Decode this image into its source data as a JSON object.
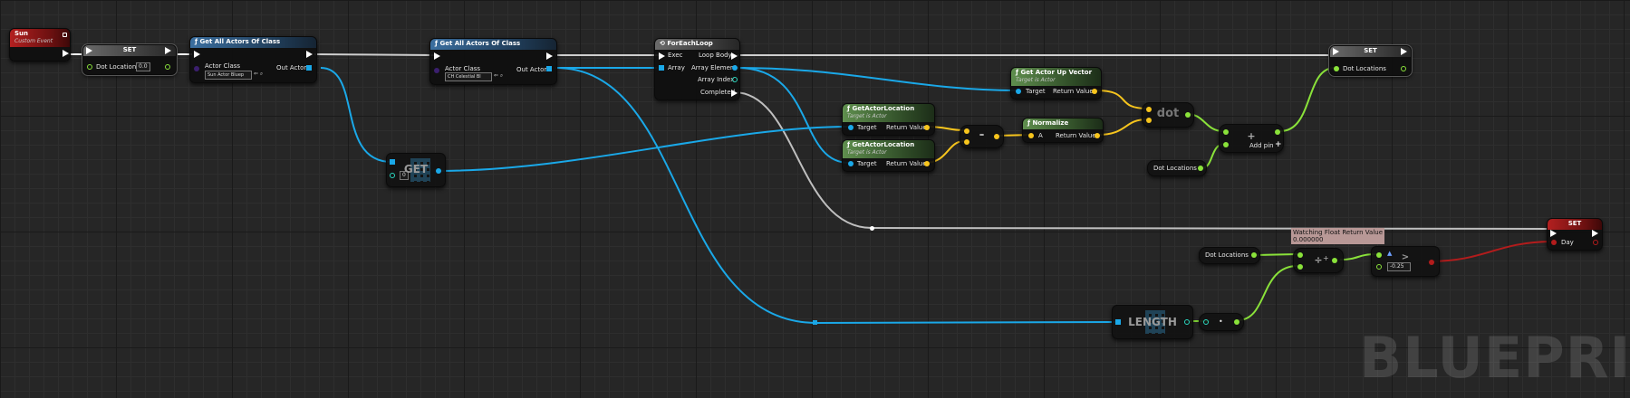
{
  "watermark": "BLUEPRINT",
  "colors": {
    "exec": "#ffffff",
    "object": "#1aa8e8",
    "vector": "#f7c51d",
    "float": "#8ae23a",
    "bool": "#b31c1c",
    "integer": "#2ad8c0"
  },
  "nodes": {
    "sun_event": {
      "title": "Sun",
      "subtitle": "Custom Event"
    },
    "set_dot_1": {
      "title": "SET",
      "pin": "Dot Locations",
      "value": "0.0"
    },
    "get_all_1": {
      "title": "Get All Actors Of Class",
      "in": "Actor Class",
      "out": "Out Actors",
      "class_value": "Sun Actor Bluep"
    },
    "get_all_2": {
      "title": "Get All Actors Of Class",
      "in": "Actor Class",
      "out": "Out Actors",
      "class_value": "CH Celestial Bl"
    },
    "foreach": {
      "title": "ForEachLoop",
      "exec": "Exec",
      "array": "Array",
      "loop_body": "Loop Body",
      "array_element": "Array Element",
      "array_index": "Array Index",
      "completed": "Completed"
    },
    "up_vector": {
      "title": "Get Actor Up Vector",
      "subtitle": "Target is Actor",
      "target": "Target",
      "ret": "Return Value"
    },
    "loc1": {
      "title": "GetActorLocation",
      "subtitle": "Target is Actor",
      "target": "Target",
      "ret": "Return Value"
    },
    "loc2": {
      "title": "GetActorLocation",
      "subtitle": "Target is Actor",
      "target": "Target",
      "ret": "Return Value"
    },
    "subtract": {
      "glyph": "-"
    },
    "normalize": {
      "title": "Normalize",
      "a": "A",
      "ret": "Return Value"
    },
    "dot": {
      "glyph": "dot"
    },
    "add": {
      "glyph": "+",
      "add_pin": "Add pin"
    },
    "set_dot_2": {
      "title": "SET",
      "pin": "Dot Locations"
    },
    "dot_var_1": {
      "label": "Dot Locations"
    },
    "dot_var_2": {
      "label": "Dot Locations"
    },
    "get": {
      "glyph": "GET",
      "index": "0"
    },
    "length": {
      "glyph": "LENGTH"
    },
    "divide": {
      "glyph": "÷"
    },
    "compare": {
      "glyph": ">",
      "value": "-0.25"
    },
    "set_day": {
      "title": "SET",
      "pin": "Day"
    },
    "watch": {
      "line1": "Watching Float Return Value",
      "line2": "0.000000"
    }
  }
}
